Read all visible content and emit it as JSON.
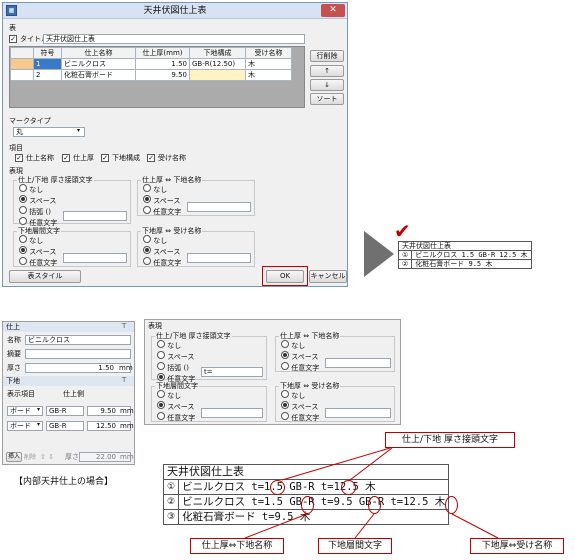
{
  "dialog": {
    "title": "天井伏図仕上表",
    "close": "✕",
    "table_section": "表",
    "title_checkbox": "タイトル",
    "title_value": "天井伏図仕上表",
    "grid": {
      "headers": [
        "符号",
        "仕上名称",
        "仕上厚(mm)",
        "下地構成",
        "受け名称"
      ],
      "rows": [
        [
          "1",
          "ビニルクロス",
          "1.50",
          "GB-R(12.50)",
          "木"
        ],
        [
          "2",
          "化粧石膏ボード",
          "9.50",
          "",
          "木"
        ]
      ]
    },
    "side_buttons": {
      "delete_row": "行削除",
      "up": "↑",
      "down": "↓",
      "sort": "ソート"
    },
    "mark_type_label": "マークタイプ",
    "mark_type_value": "丸",
    "items_label": "項目",
    "items": [
      "仕上名称",
      "仕上厚",
      "下地構成",
      "受け名称"
    ],
    "expression_label": "表現",
    "group1": {
      "title": "仕上/下地 厚さ接頭文字",
      "options": [
        "なし",
        "スペース",
        "括弧 ()",
        "任意文字"
      ],
      "selected": 1
    },
    "group2": {
      "title": "仕上厚 ⇔ 下地名称",
      "options": [
        "なし",
        "スペース",
        "任意文字"
      ],
      "selected": 1
    },
    "group3": {
      "title": "下地層間文字",
      "options": [
        "なし",
        "スペース",
        "任意文字"
      ],
      "selected": 1
    },
    "group4": {
      "title": "下地厚 ⇔ 受け名称",
      "options": [
        "なし",
        "スペース",
        "任意文字"
      ],
      "selected": 1
    },
    "table_style_button": "表スタイル",
    "ok_button": "OK",
    "cancel_button": "キャンセル"
  },
  "preview1": {
    "title": "天井伏図仕上表",
    "rows": [
      {
        "mark": "①",
        "text": "ビニルクロス 1.5 GB-R 12.5 木"
      },
      {
        "mark": "②",
        "text": "化粧石膏ボード 9.5 木"
      }
    ]
  },
  "props": {
    "finish_header": "仕上",
    "name_label": "名称",
    "name_value": "ビニルクロス",
    "summary_label": "摘要",
    "thickness_label": "厚さ",
    "thickness_value": "1.50",
    "unit": "mm",
    "base_header": "下地",
    "display_items": "表示項目",
    "finish_side": "仕上側",
    "base_rows": [
      {
        "type": "ボード",
        "name": "GB-R",
        "value": "9.50"
      },
      {
        "type": "ボード",
        "name": "GB-R",
        "value": "12.50"
      }
    ],
    "insert_button": "挿入",
    "delete_button": "削除",
    "total_label": "厚さ",
    "total_value": "22.00"
  },
  "expr2": {
    "label": "表現",
    "group1": {
      "title": "仕上/下地 厚さ接頭文字",
      "options": [
        "なし",
        "スペース",
        "括弧 ()",
        "任意文字"
      ],
      "selected": 3,
      "custom_value": "t="
    },
    "group2": {
      "title": "仕上厚 ⇔ 下地名称",
      "options": [
        "なし",
        "スペース",
        "任意文字"
      ],
      "selected": 1
    },
    "group3": {
      "title": "下地層間文字",
      "options": [
        "なし",
        "スペース",
        "任意文字"
      ],
      "selected": 1
    },
    "group4": {
      "title": "下地厚 ⇔ 受け名称",
      "options": [
        "なし",
        "スペース",
        "任意文字"
      ],
      "selected": 1
    }
  },
  "caption": "【内部天井仕上の場合】",
  "preview2": {
    "title": "天井伏図仕上表",
    "rows": [
      {
        "mark": "①",
        "text": "ビニルクロス t=1.5 GB-R t=12.5 木"
      },
      {
        "mark": "②",
        "text": "ビニルクロス t=1.5 GB-R t=9.5 GB-R t=12.5 木"
      },
      {
        "mark": "③",
        "text": "化粧石膏ボード t=9.5 木"
      }
    ]
  },
  "callouts": {
    "prefix": "仕上/下地 厚さ接頭文字",
    "finish_base": "仕上厚⇔下地名称",
    "between": "下地層間文字",
    "base_receive": "下地厚⇔受け名称"
  },
  "colors": {
    "accent": "#c00000",
    "selection": "#3a78c8",
    "arrow": "#707070"
  }
}
